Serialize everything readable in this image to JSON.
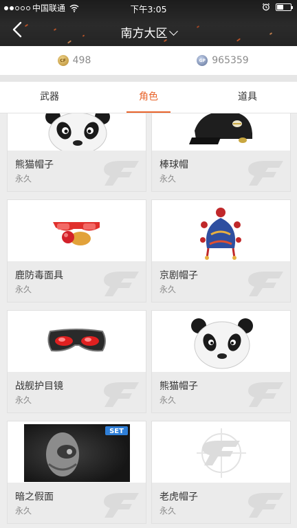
{
  "status_bar": {
    "carrier": "中国联通",
    "time": "下午3:05"
  },
  "header": {
    "title": "南方大区",
    "icons": [
      "back-arrow-icon",
      "chevron-down-icon"
    ]
  },
  "currency": {
    "gold_value": "498",
    "gp_value": "965359"
  },
  "tabs": [
    {
      "label": "武器",
      "active": false
    },
    {
      "label": "角色",
      "active": true
    },
    {
      "label": "道具",
      "active": false
    }
  ],
  "items": [
    {
      "name": "熊猫帽子",
      "duration": "永久",
      "icon": "panda-hat"
    },
    {
      "name": "棒球帽",
      "duration": "永久",
      "icon": "baseball-cap"
    },
    {
      "name": "鹿防毒面具",
      "duration": "永久",
      "icon": "reindeer-mask"
    },
    {
      "name": "京剧帽子",
      "duration": "永久",
      "icon": "opera-hat"
    },
    {
      "name": "战舰护目镜",
      "duration": "永久",
      "icon": "goggles"
    },
    {
      "name": "熊猫帽子",
      "duration": "永久",
      "icon": "panda-hat"
    },
    {
      "name": "暗之假面",
      "duration": "永久",
      "icon": "dark-mask",
      "badge": "SET"
    },
    {
      "name": "老虎帽子",
      "duration": "永久",
      "icon": "cf-placeholder"
    }
  ],
  "colors": {
    "accent": "#e8632a",
    "header_bg": "#1f1f1f"
  }
}
